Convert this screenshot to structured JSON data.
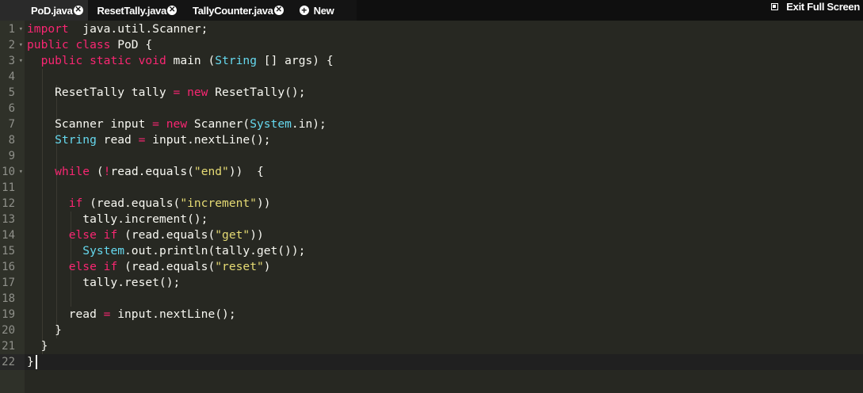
{
  "tabs": [
    {
      "label": "PoD.java",
      "active": true
    },
    {
      "label": "ResetTally.java",
      "active": false
    },
    {
      "label": "TallyCounter.java",
      "active": false
    }
  ],
  "new_tab_label": "New",
  "exit_fullscreen_label": "Exit Full Screen",
  "editor": {
    "active_line": 22,
    "lines": [
      {
        "n": "1",
        "fold": true
      },
      {
        "n": "2",
        "fold": true
      },
      {
        "n": "3",
        "fold": true
      },
      {
        "n": "4",
        "fold": false
      },
      {
        "n": "5",
        "fold": false
      },
      {
        "n": "6",
        "fold": false
      },
      {
        "n": "7",
        "fold": false
      },
      {
        "n": "8",
        "fold": false
      },
      {
        "n": "9",
        "fold": false
      },
      {
        "n": "10",
        "fold": true
      },
      {
        "n": "11",
        "fold": false
      },
      {
        "n": "12",
        "fold": false
      },
      {
        "n": "13",
        "fold": false
      },
      {
        "n": "14",
        "fold": false
      },
      {
        "n": "15",
        "fold": false
      },
      {
        "n": "16",
        "fold": false
      },
      {
        "n": "17",
        "fold": false
      },
      {
        "n": "18",
        "fold": false
      },
      {
        "n": "19",
        "fold": false
      },
      {
        "n": "20",
        "fold": false
      },
      {
        "n": "21",
        "fold": false
      },
      {
        "n": "22",
        "fold": false
      }
    ],
    "code": [
      [
        [
          "kw",
          "import"
        ],
        [
          "",
          "  java.util.Scanner;"
        ]
      ],
      [
        [
          "kw",
          "public"
        ],
        [
          "",
          " "
        ],
        [
          "kw",
          "class"
        ],
        [
          "",
          " PoD {"
        ]
      ],
      [
        [
          "",
          "  "
        ],
        [
          "kw",
          "public"
        ],
        [
          "",
          " "
        ],
        [
          "kw",
          "static"
        ],
        [
          "",
          " "
        ],
        [
          "kw",
          "void"
        ],
        [
          "",
          " main ("
        ],
        [
          "ty",
          "String"
        ],
        [
          "",
          " [] args) {"
        ]
      ],
      [
        [
          "",
          ""
        ]
      ],
      [
        [
          "",
          "    ResetTally tally "
        ],
        [
          "kw",
          "="
        ],
        [
          "",
          " "
        ],
        [
          "kw",
          "new"
        ],
        [
          "",
          " ResetTally();"
        ]
      ],
      [
        [
          "",
          ""
        ]
      ],
      [
        [
          "",
          "    Scanner input "
        ],
        [
          "kw",
          "="
        ],
        [
          "",
          " "
        ],
        [
          "kw",
          "new"
        ],
        [
          "",
          " Scanner("
        ],
        [
          "ty",
          "System"
        ],
        [
          "",
          ".in);"
        ]
      ],
      [
        [
          "",
          "    "
        ],
        [
          "ty",
          "String"
        ],
        [
          "",
          " read "
        ],
        [
          "kw",
          "="
        ],
        [
          "",
          " input.nextLine();"
        ]
      ],
      [
        [
          "",
          ""
        ]
      ],
      [
        [
          "",
          "    "
        ],
        [
          "kw",
          "while"
        ],
        [
          "",
          " ("
        ],
        [
          "kw",
          "!"
        ],
        [
          "",
          "read.equals("
        ],
        [
          "st",
          "\"end\""
        ],
        [
          "",
          "))  {"
        ]
      ],
      [
        [
          "",
          ""
        ]
      ],
      [
        [
          "",
          "      "
        ],
        [
          "kw",
          "if"
        ],
        [
          "",
          " (read.equals("
        ],
        [
          "st",
          "\"increment\""
        ],
        [
          "",
          "))"
        ]
      ],
      [
        [
          "",
          "        tally.increment();"
        ]
      ],
      [
        [
          "",
          "      "
        ],
        [
          "kw",
          "else"
        ],
        [
          "",
          " "
        ],
        [
          "kw",
          "if"
        ],
        [
          "",
          " (read.equals("
        ],
        [
          "st",
          "\"get\""
        ],
        [
          "",
          "))"
        ]
      ],
      [
        [
          "",
          "        "
        ],
        [
          "ty",
          "System"
        ],
        [
          "",
          ".out.println(tally.get());"
        ]
      ],
      [
        [
          "",
          "      "
        ],
        [
          "kw",
          "else"
        ],
        [
          "",
          " "
        ],
        [
          "kw",
          "if"
        ],
        [
          "",
          " (read.equals("
        ],
        [
          "st",
          "\"reset\""
        ],
        [
          "",
          ")"
        ]
      ],
      [
        [
          "",
          "        tally.reset();"
        ]
      ],
      [
        [
          "",
          ""
        ]
      ],
      [
        [
          "",
          "      read "
        ],
        [
          "kw",
          "="
        ],
        [
          "",
          " input.nextLine();"
        ]
      ],
      [
        [
          "",
          "    }"
        ]
      ],
      [
        [
          "",
          "  }"
        ]
      ],
      [
        [
          "",
          "}"
        ]
      ]
    ]
  },
  "colors": {
    "keyword": "#f92672",
    "type": "#66d9ef",
    "string": "#e6db74",
    "text": "#f8f8f2",
    "background": "#272822"
  }
}
